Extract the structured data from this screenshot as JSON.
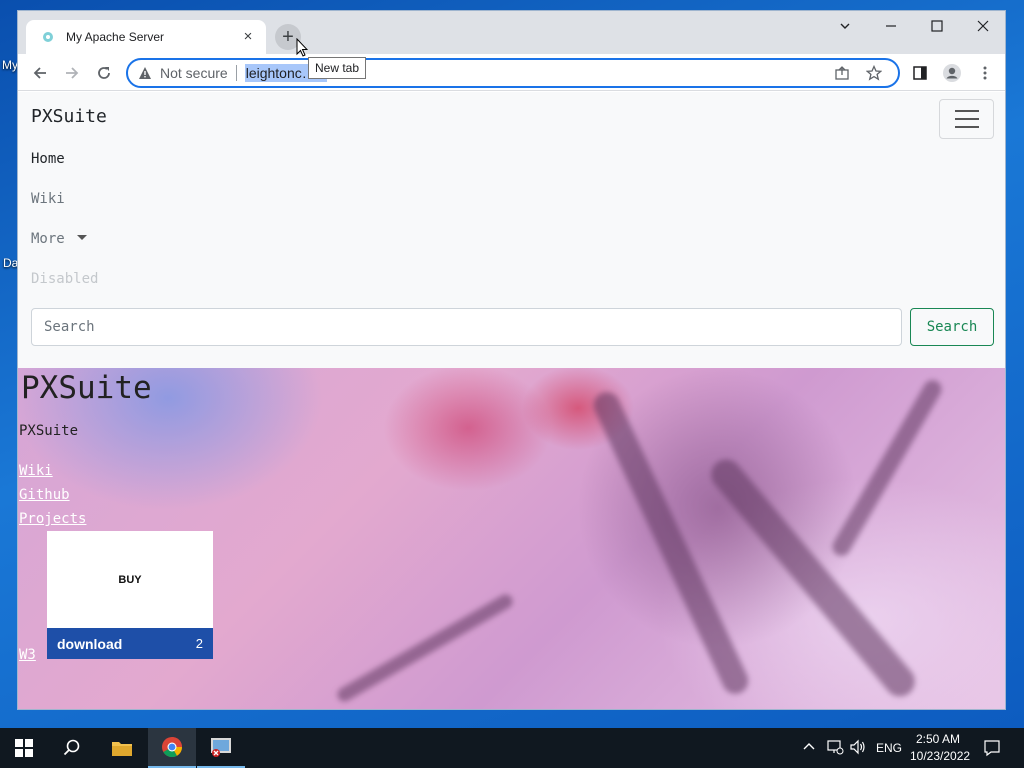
{
  "desktop": {
    "icon1_label": "My",
    "icon2_label": "Da"
  },
  "browser": {
    "tab_title": "My Apache Server",
    "tab_close": "×",
    "newtab_glyph": "+",
    "tooltip": "New tab",
    "security_label": "Not secure",
    "url": "leightonc…iz"
  },
  "navbar": {
    "brand": "PXSuite",
    "links": [
      {
        "label": "Home",
        "color": "#212529"
      },
      {
        "label": "Wiki",
        "color": "#6c757d"
      },
      {
        "label": "More",
        "color": "#6c757d"
      },
      {
        "label": "Disabled",
        "color": "#c4c8cc"
      }
    ],
    "search_placeholder": "Search",
    "search_button": "Search"
  },
  "hero": {
    "title": "PXSuite",
    "subtitle": "PXSuite",
    "links": [
      "Wiki",
      "Github",
      "Projects"
    ],
    "w3_link": "W3",
    "card": {
      "buy_label": "BUY",
      "download_label": "download",
      "count": "2"
    }
  },
  "taskbar": {
    "language": "ENG",
    "time": "2:50 AM",
    "date": "10/23/2022"
  },
  "colors": {
    "accent": "#1a73e8",
    "success": "#198754",
    "card_bar": "#1e4fa8"
  }
}
